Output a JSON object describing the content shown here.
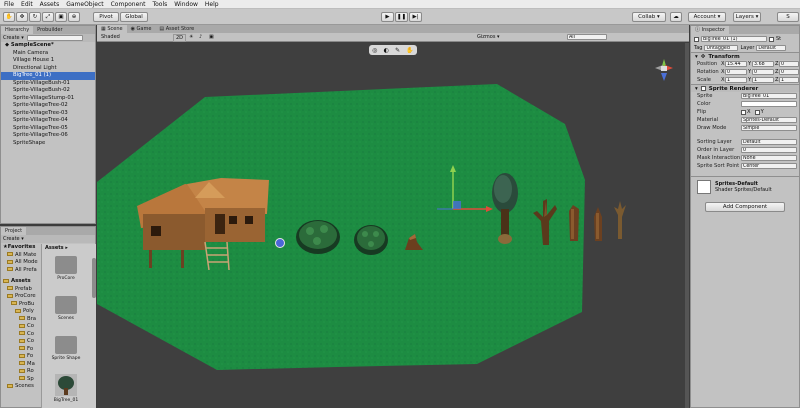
{
  "menu": [
    "File",
    "Edit",
    "Assets",
    "GameObject",
    "Component",
    "Tools",
    "Window",
    "Help"
  ],
  "toolbar": {
    "pivot": "Pivot",
    "global": "Global",
    "collab": "Collab ▾",
    "account": "Account ▾",
    "layers": "Layers ▾",
    "layout": "S"
  },
  "hierarchy": {
    "tabs": [
      "Hierarchy",
      "Probuilder"
    ],
    "create": "Create ▾",
    "search": "",
    "scene": "SampleScene*",
    "items": [
      "Main Camera",
      "Village House 1",
      "Directional Light",
      "BigTree_01 (1)",
      "Sprite-VillageBush-01",
      "Sprite-VillageBush-02",
      "Sprite-VillageStump-01",
      "Sprite-VillageTree-02",
      "Sprite-VillageTree-03",
      "Sprite-VillageTree-04",
      "Sprite-VillageTree-05",
      "Sprite-VillageTree-06",
      "SpriteShape"
    ]
  },
  "project": {
    "tab": "Project",
    "create": "Create ▾",
    "favorites_header": "Favorites",
    "favorites": [
      "All Mate",
      "All Mode",
      "All Prefa"
    ],
    "assets_header": "Assets",
    "tree": [
      "Prefab",
      "ProCore",
      "ProBu",
      "Poly",
      "Bra",
      "Co",
      "Co",
      "Co",
      "Fo",
      "Fo",
      "Ma",
      "Ro",
      "Sp",
      "Scenes"
    ],
    "crumb": "Assets ▸",
    "grid_items": [
      "ProCore",
      "Scenes",
      "Sprite Shape",
      "BigTree_01"
    ]
  },
  "scene_view": {
    "tabs": [
      "Scene",
      "Game",
      "Asset Store"
    ],
    "shading": "Shaded",
    "mode2d": "2D",
    "gizmos": "Gizmos ▾",
    "search": "All"
  },
  "inspector": {
    "tab": "Inspector",
    "object_name": "BigTree_01 (1)",
    "static": "St",
    "tag_label": "Tag",
    "tag": "Untagged",
    "layer_label": "Layer",
    "layer": "Default",
    "transform": {
      "title": "Transform",
      "position_label": "Position",
      "rotation_label": "Rotation",
      "scale_label": "Scale",
      "position": {
        "x": "15.44",
        "y": "3.68",
        "z": "0"
      },
      "rotation": {
        "x": "0",
        "y": "0",
        "z": "0"
      },
      "scale": {
        "x": "1",
        "y": "1",
        "z": "1"
      }
    },
    "sprite_renderer": {
      "title": "Sprite Renderer",
      "sprite_label": "Sprite",
      "sprite": "BigTree_01",
      "color_label": "Color",
      "flip_label": "Flip",
      "flip_x": "X",
      "flip_y": "Y",
      "material_label": "Material",
      "material": "Sprites-Default",
      "draw_mode_label": "Draw Mode",
      "draw_mode": "Simple",
      "sorting_layer_label": "Sorting Layer",
      "sorting_layer": "Default",
      "order_label": "Order in Layer",
      "order": "0",
      "mask_label": "Mask Interaction",
      "mask": "None",
      "sort_point_label": "Sprite Sort Point",
      "sort_point": "Center"
    },
    "material_preview": {
      "name": "Sprites-Default",
      "shader_label": "Shader",
      "shader": "Sprites/Default"
    },
    "add_component": "Add Component"
  },
  "colors": {
    "grass": "#1d8c42",
    "selection": "#3d6fc4",
    "scene_bg": "#3f3f3f"
  }
}
